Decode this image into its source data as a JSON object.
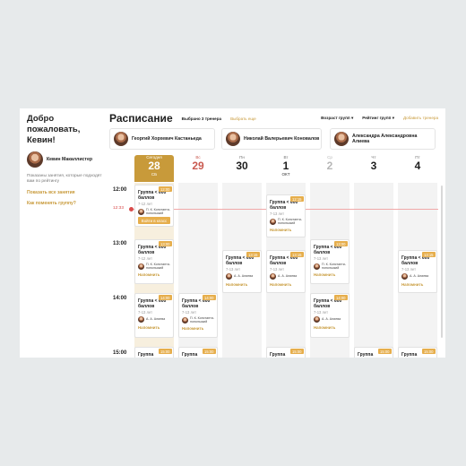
{
  "sidebar": {
    "greeting": "Добро пожаловать, Кевин!",
    "user_name": "Кевин Макаллистер",
    "description": "Показаны занятия, которые подходят вам по рейтингу",
    "show_all": "Показать все занятия",
    "change_group": "Как поменять группу?"
  },
  "header": {
    "title": "Расписание",
    "selected_coaches": "Выбрано 3 тренера",
    "choose_more": "Выбрать еще",
    "age_filter": "Возраст групп",
    "rating_filter": "Рейтинг групп",
    "add_filters": "Добавить тренера",
    "chevron": "▾"
  },
  "coaches": [
    {
      "name": "Георгий Хорхевич Кастаньеда"
    },
    {
      "name": "Николай Валерьевич Коновалов"
    },
    {
      "name": "Александра Александровна Алиева"
    }
  ],
  "days": [
    {
      "dow": "Сегодня",
      "num": "28",
      "mon": "СБ"
    },
    {
      "dow": "Вс",
      "num": "29",
      "mon": ""
    },
    {
      "dow": "Пн",
      "num": "30",
      "mon": ""
    },
    {
      "dow": "Вт",
      "num": "1",
      "mon": "ОКТ"
    },
    {
      "dow": "Ср",
      "num": "2",
      "mon": ""
    },
    {
      "dow": "Чт",
      "num": "3",
      "mon": ""
    },
    {
      "dow": "Пт",
      "num": "4",
      "mon": ""
    }
  ],
  "times": [
    "12:00",
    "13:00",
    "14:00",
    "15:00"
  ],
  "now_label": "12:33",
  "cards": [
    {
      "time": "12:00",
      "group": "Группа < 600 баллов",
      "age": "7-12 лет",
      "coach": "П. К. Константи-нопольский",
      "action": "Войти в класс"
    },
    {
      "time": "12:15",
      "group": "Группа < 600 баллов",
      "age": "7-13 лет",
      "coach": "П. К. Константи-нопольский",
      "action": "Напомнить"
    },
    {
      "time": "13:15",
      "group": "Группа < 600 баллов",
      "age": "7-13 лет",
      "coach": "А. А. Алиева",
      "action": "Напомнить"
    },
    {
      "time": "13:15",
      "group": "Группа < 600 баллов",
      "age": "7-13 лет",
      "coach": "А. А. Алиева",
      "action": "Напомнить"
    },
    {
      "time": "13:00",
      "group": "Группа < 600 баллов",
      "age": "7-12 лет",
      "coach": "П. К. Константи-нопольский",
      "action": "Напомнить"
    },
    {
      "time": "13:00",
      "group": "Группа < 600 баллов",
      "age": "7-13 лет",
      "coach": "П. К. Константи-нопольский",
      "action": "Напомнить"
    },
    {
      "time": "13:15",
      "group": "Группа < 600 баллов",
      "age": "7-13 лет",
      "coach": "А. А. Алиева",
      "action": "Напомнить"
    },
    {
      "time": "14:00",
      "group": "Группа < 600 баллов",
      "age": "7-13 лет",
      "coach": "А. А. Алиева",
      "action": "Напомнить"
    },
    {
      "time": "14:00",
      "group": "Группа < 600 баллов",
      "age": "7-13 лет",
      "coach": "П. К. Константи-нопольский",
      "action": "Напомнить"
    },
    {
      "time": "14:00",
      "group": "Группа < 600 баллов",
      "age": "7-13 лет",
      "coach": "А. А. Алиева",
      "action": "Напомнить"
    },
    {
      "time": "15:00",
      "group": "Группа",
      "age": "",
      "coach": "",
      "action": ""
    },
    {
      "time": "15:00",
      "group": "Группа",
      "age": "",
      "coach": "",
      "action": ""
    },
    {
      "time": "15:00",
      "group": "Группа",
      "age": "",
      "coach": "",
      "action": ""
    },
    {
      "time": "15:00",
      "group": "Группа",
      "age": "",
      "coach": "",
      "action": ""
    },
    {
      "time": "15:00",
      "group": "Группа",
      "age": "",
      "coach": "",
      "action": ""
    }
  ],
  "colors": {
    "accent": "#c89a3a",
    "badge": "#e6ae4c",
    "now": "#d84b4b"
  }
}
